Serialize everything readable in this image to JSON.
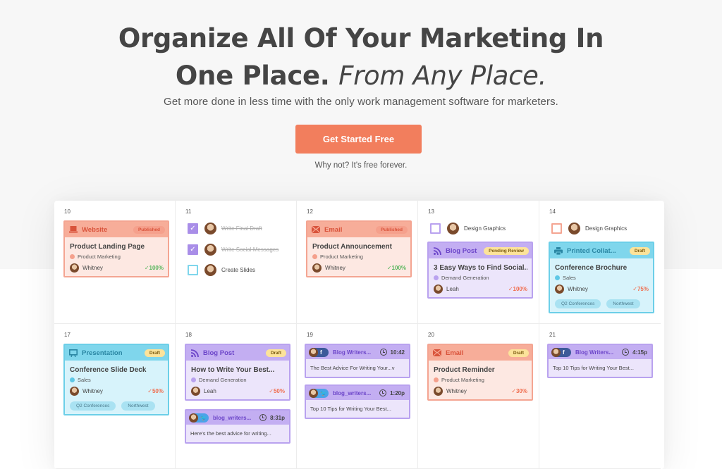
{
  "hero": {
    "headline_line1": "Organize All Of Your Marketing In",
    "headline_line2_plain": "One Place.",
    "headline_line2_italic": "From Any Place.",
    "subheadline": "Get more done in less time with the only work management software for marketers.",
    "cta_label": "Get Started Free",
    "cta_note": "Why not? It's free forever."
  },
  "colors": {
    "cta": "#f27e5d",
    "red_theme": "#f7ad99",
    "purple_theme": "#c3aef2",
    "blue_theme": "#7fd6ec",
    "draft_badge": "#fce39a"
  },
  "calendar": {
    "days": [
      {
        "num": "10"
      },
      {
        "num": "11"
      },
      {
        "num": "12"
      },
      {
        "num": "13"
      },
      {
        "num": "14"
      },
      {
        "num": "17"
      },
      {
        "num": "18"
      },
      {
        "num": "19"
      },
      {
        "num": "20"
      },
      {
        "num": "21"
      }
    ],
    "cards": {
      "d10": {
        "type": "Website",
        "icon": "laptop-icon",
        "status": "Published",
        "title": "Product Landing Page",
        "category": "Product Marketing",
        "owner": "Whitney",
        "progress": "100%"
      },
      "d12": {
        "type": "Email",
        "icon": "envelope-icon",
        "status": "Published",
        "title": "Product Announcement",
        "category": "Product Marketing",
        "owner": "Whitney",
        "progress": "100%"
      },
      "d13": {
        "type": "Blog Post",
        "icon": "rss-icon",
        "status": "Pending Review",
        "title": "3 Easy Ways to Find Social...",
        "category": "Demand Generation",
        "owner": "Leah",
        "progress": "100%"
      },
      "d14": {
        "type": "Printed Collat...",
        "icon": "printer-icon",
        "status": "Draft",
        "title": "Conference Brochure",
        "category": "Sales",
        "owner": "Whitney",
        "progress": "75%",
        "tags": [
          "Q2 Conferences",
          "Northwest"
        ]
      },
      "d17": {
        "type": "Presentation",
        "icon": "presentation-icon",
        "status": "Draft",
        "title": "Conference Slide Deck",
        "category": "Sales",
        "owner": "Whitney",
        "progress": "50%",
        "tags": [
          "Q2 Conferences",
          "Northwest"
        ]
      },
      "d18": {
        "type": "Blog Post",
        "icon": "rss-icon",
        "status": "Draft",
        "title": "How to Write Your Best...",
        "category": "Demand Generation",
        "owner": "Leah",
        "progress": "50%"
      },
      "d20": {
        "type": "Email",
        "icon": "envelope-icon",
        "status": "Draft",
        "title": "Product Reminder",
        "category": "Product Marketing",
        "owner": "Whitney",
        "progress": "30%"
      }
    },
    "todos": {
      "d11": [
        {
          "label": "Write Final Draft",
          "checked": true
        },
        {
          "label": "Write Social Messages",
          "checked": true
        },
        {
          "label": "Create Slides",
          "checked": false
        }
      ],
      "d13": [
        {
          "label": "Design Graphics",
          "checked": false
        }
      ],
      "d14": [
        {
          "label": "Design Graphics",
          "checked": false
        }
      ]
    },
    "social": {
      "d18": [
        {
          "network": "twitter",
          "account": "blog_writers...",
          "time": "8:31p",
          "text": "Here's the best advice for writing..."
        }
      ],
      "d19": [
        {
          "network": "facebook",
          "account": "Blog Writers...",
          "time": "10:42",
          "text": "The Best Advice For Writing Your...v"
        },
        {
          "network": "twitter",
          "account": "blog_writers...",
          "time": "1:20p",
          "text": "Top 10 Tips for Writing Your Best..."
        }
      ],
      "d21": [
        {
          "network": "facebook",
          "account": "Blog Writers...",
          "time": "4:15p",
          "text": "Top 10 Tips for Writing Your Best..."
        }
      ]
    }
  }
}
